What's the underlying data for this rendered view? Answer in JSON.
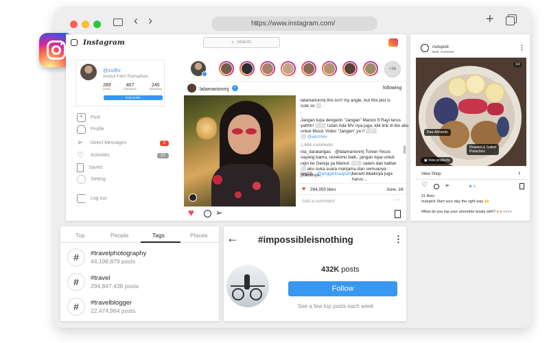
{
  "browser": {
    "url": "https://www.instagram.com/",
    "colors": {
      "red": "#ff5f57",
      "yellow": "#febc2e",
      "green": "#28c840"
    }
  },
  "header": {
    "wordmark": "Instagram",
    "search_placeholder": "search"
  },
  "profile": {
    "username": "@zulfhr",
    "full_name": "Anizuli Fahri Ramadhan",
    "stats": [
      {
        "value": "289",
        "label": "posts"
      },
      {
        "value": "407",
        "label": "followers"
      },
      {
        "value": "245",
        "label": "following"
      }
    ],
    "edit_label": "Edit Profile"
  },
  "sidebar": {
    "items": [
      {
        "label": "Post",
        "icon": "plus-square-icon"
      },
      {
        "label": "Profile",
        "icon": "user-icon"
      },
      {
        "label": "Direct Messages",
        "icon": "send-icon",
        "badge": "3"
      },
      {
        "label": "Activities",
        "icon": "heart-icon",
        "badge": "57"
      },
      {
        "label": "Saved",
        "icon": "bookmark-icon"
      },
      {
        "label": "Setting",
        "icon": "gear-icon"
      }
    ],
    "logout": "Log out"
  },
  "stories": {
    "more": "+36"
  },
  "post": {
    "username": "lalamarionmj",
    "follow_state": "following",
    "caption_lines": [
      "lalamarionmj   this isn't my angle, but this pict is",
      "cute so ⬜ .",
      ".",
      ".",
      "Jangan lupa dengerin \"Jangan\" Marion ft Rayi terus",
      "yahhh! ⬜⬜ Udah Ada MV nya juga, klik link di bio aku",
      "untuk Music Video \"Jangan\" ya !! ⬜⬜",
      "⬜ @eezmex"
    ],
    "comment_count": "1,684 comments",
    "comment1_user": "nia_daratarigas",
    "comment1_text": "@lalamarionmj Tuhan Yesus sayang kamu, rezekimu baik.. jangan lupa untuk rajin ke Gereja ya Marion ⬜⬜ salam dari kalbar ⬜ aku suka suara manjamu dan semuanya pokoknya...",
    "comment2_user": "tanj15",
    "comment2_mention": "@anggelinaaputry",
    "comment2_text": "berarti itibaknya juga harus...",
    "likes": "264,050 likes",
    "date": "June, 16",
    "add_comment": "Add a comment"
  },
  "ad_post": {
    "username": "nutspick",
    "location": "Bath, Somerset",
    "slide_counter": "1/2",
    "tag1": "Raw Almonds",
    "tag2_line1": "Roasted & Salted",
    "tag2_line2": "Pistachios",
    "view_products": "View products",
    "view_shop": "View Shop",
    "likes": "21 likes",
    "caption_user": "nutspick",
    "caption_text": "Start your day the right way 🙌",
    "comment_text": "What do you top your smoothie bowls with?",
    "more": "more"
  },
  "search_tabs": {
    "tabs": [
      "Top",
      "People",
      "Tags",
      "Places"
    ],
    "active": "Tags",
    "tags": [
      {
        "name": "#travelphotography",
        "count": "44,198,879 posts"
      },
      {
        "name": "#travel",
        "count": "294,847,438 posts"
      },
      {
        "name": "#travelblogger",
        "count": "22,474,964 posts"
      }
    ]
  },
  "hashtag_page": {
    "title": "#impossibleisnothing",
    "posts_count": "432K",
    "posts_label": "posts",
    "follow_label": "Follow",
    "subtitle": "See a few top posts each week"
  }
}
